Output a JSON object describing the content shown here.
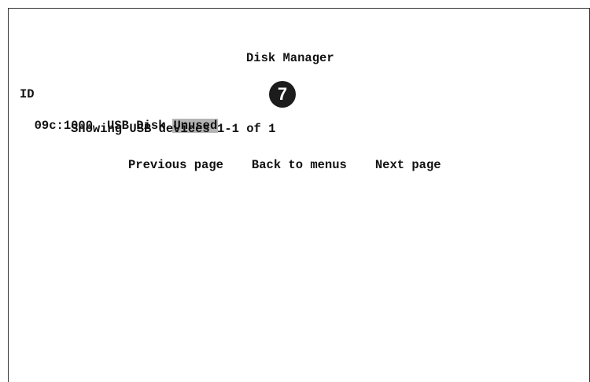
{
  "screen": {
    "title": "Disk Manager"
  },
  "device_table": {
    "header": "ID",
    "rows": [
      {
        "id": "09c:1000",
        "type": "USB Disk",
        "status": "Unused"
      }
    ],
    "summary": "Showing USB devices 1-1 of 1"
  },
  "navigation": {
    "previous": "Previous page",
    "back": "Back to menus",
    "next": "Next page"
  },
  "annotation": {
    "callout_number": "7"
  },
  "colors": {
    "highlight": "#b4b4b4",
    "callout_bg": "#1c1c1c",
    "text": "#111111"
  }
}
